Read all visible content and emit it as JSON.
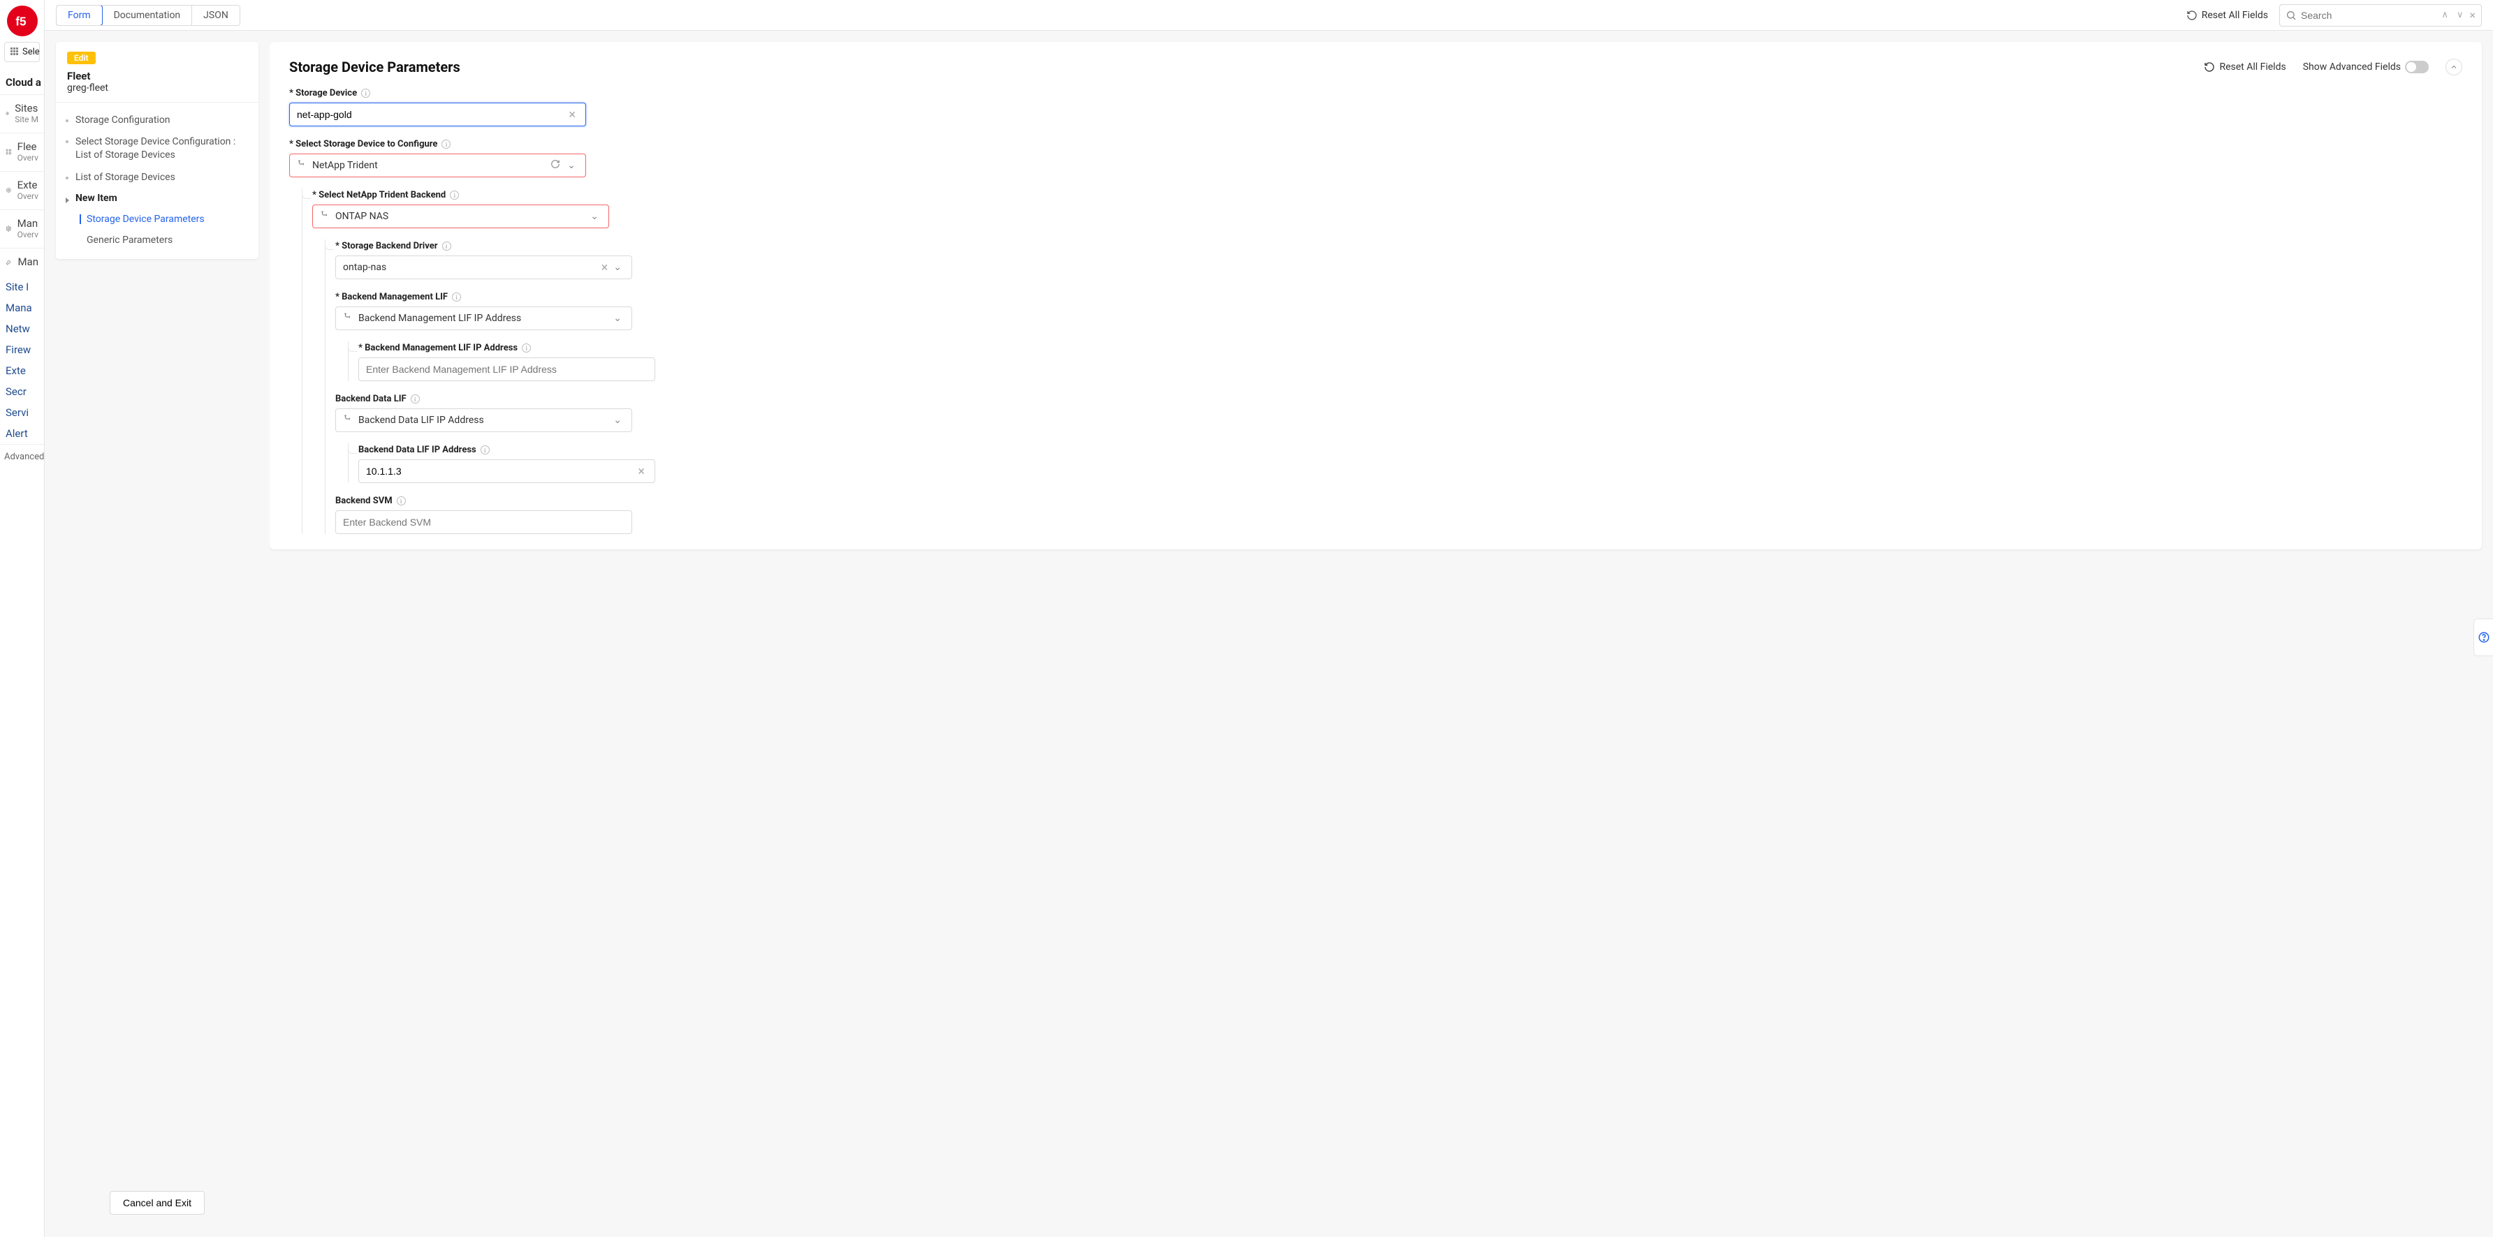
{
  "bg": {
    "select_btn": "Select",
    "title": "Cloud a",
    "sections": [
      {
        "label": "Sites",
        "sub": "Site M"
      },
      {
        "label": "Flee",
        "sub": "Overv"
      },
      {
        "label": "Exte",
        "sub": "Overv"
      },
      {
        "label": "Man",
        "sub": "Overv"
      },
      {
        "label": "Man",
        "sub": ""
      }
    ],
    "links": [
      "Site I",
      "Mana",
      "Netw",
      "Firew",
      "Exte",
      "Secr",
      "Servi",
      "Alert"
    ],
    "advanced": "Advanced"
  },
  "topbar": {
    "tabs": {
      "form": "Form",
      "documentation": "Documentation",
      "json": "JSON"
    },
    "reset_all": "Reset All Fields",
    "search_placeholder": "Search"
  },
  "tree": {
    "badge": "Edit",
    "title": "Fleet",
    "subtitle": "greg-fleet",
    "items": {
      "storage_config": "Storage Configuration",
      "select_storage_device_config": "Select Storage Device Configuration : List of Storage Devices",
      "list_storage_devices": "List of Storage Devices",
      "new_item": "New Item",
      "storage_device_parameters": "Storage Device Parameters",
      "generic_parameters": "Generic Parameters"
    },
    "cancel": "Cancel and Exit"
  },
  "form": {
    "header_title": "Storage Device Parameters",
    "reset_all": "Reset All Fields",
    "show_advanced": "Show Advanced Fields",
    "storage_device_label": "Storage Device",
    "storage_device_value": "net-app-gold",
    "select_storage_device_label": "Select Storage Device to Configure",
    "select_storage_device_value": "NetApp Trident",
    "netapp_backend_label": "Select NetApp Trident Backend",
    "netapp_backend_value": "ONTAP NAS",
    "backend_driver_label": "Storage Backend Driver",
    "backend_driver_value": "ontap-nas",
    "mgmt_lif_label": "Backend Management LIF",
    "mgmt_lif_value": "Backend Management LIF IP Address",
    "mgmt_lif_ip_label": "Backend Management LIF IP Address",
    "mgmt_lif_ip_placeholder": "Enter Backend Management LIF IP Address",
    "data_lif_label": "Backend Data LIF",
    "data_lif_value": "Backend Data LIF IP Address",
    "data_lif_ip_label": "Backend Data LIF IP Address",
    "data_lif_ip_value": "10.1.1.3",
    "backend_svm_label": "Backend SVM",
    "backend_svm_placeholder": "Enter Backend SVM"
  }
}
